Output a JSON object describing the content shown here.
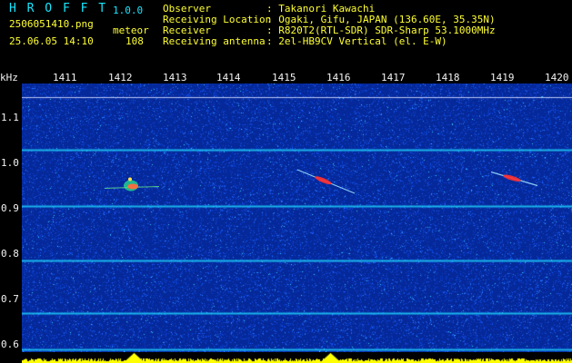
{
  "header": {
    "app_title": "H R O F F T",
    "version": "1.0.0",
    "filename": "2506051410.png",
    "timestamp": "25.06.05 14:10",
    "detection_label": "meteor",
    "detection_count": "108",
    "observer_label": "Observer",
    "observer_value": ": Takanori Kawachi",
    "location_label": "Receiving Location",
    "location_value": ": Ogaki, Gifu, JAPAN (136.60E, 35.35N)",
    "receiver_label": "Receiver",
    "receiver_value": ": R820T2(RTL-SDR) SDR-Sharp 53.1000MHz",
    "antenna_label": "Receiving antenna",
    "antenna_value": ": 2el-HB9CV Vertical (el. E-W)"
  },
  "axes": {
    "y_unit": "kHz",
    "y_ticks": [
      "1.1",
      "1.0",
      "0.9",
      "0.8",
      "0.7",
      "0.6"
    ],
    "x_ticks": [
      "1411",
      "1412",
      "1413",
      "1414",
      "1415",
      "1416",
      "1417",
      "1418",
      "1419",
      "1420"
    ]
  },
  "spectrogram": {
    "background_color": "#062a9d",
    "noise_colors": [
      "#0c43d8",
      "#1e62ff",
      "#2b8cff",
      "#38d3ff"
    ],
    "reference_line_color": "#1fd7ff",
    "meteor_colors": [
      "#ffe44d",
      "#ff6b3d",
      "#ff2d2d"
    ],
    "horizontal_lines_khz": [
      1.16,
      1.045,
      0.92,
      0.8,
      0.683,
      0.605,
      0.585
    ],
    "meteor_traces": [
      {
        "type": "burst",
        "x_minute": 1412.45,
        "y_khz": 0.965
      },
      {
        "type": "streak",
        "start_minute": 1415.55,
        "start_khz": 1.0,
        "end_minute": 1416.6,
        "end_khz": 0.948
      },
      {
        "type": "streak",
        "start_minute": 1419.1,
        "start_khz": 0.995,
        "end_minute": 1419.95,
        "end_khz": 0.965
      }
    ]
  },
  "footer": {
    "bar_color": "#ffff00",
    "peaks": [
      1412.55,
      1416.15
    ]
  }
}
